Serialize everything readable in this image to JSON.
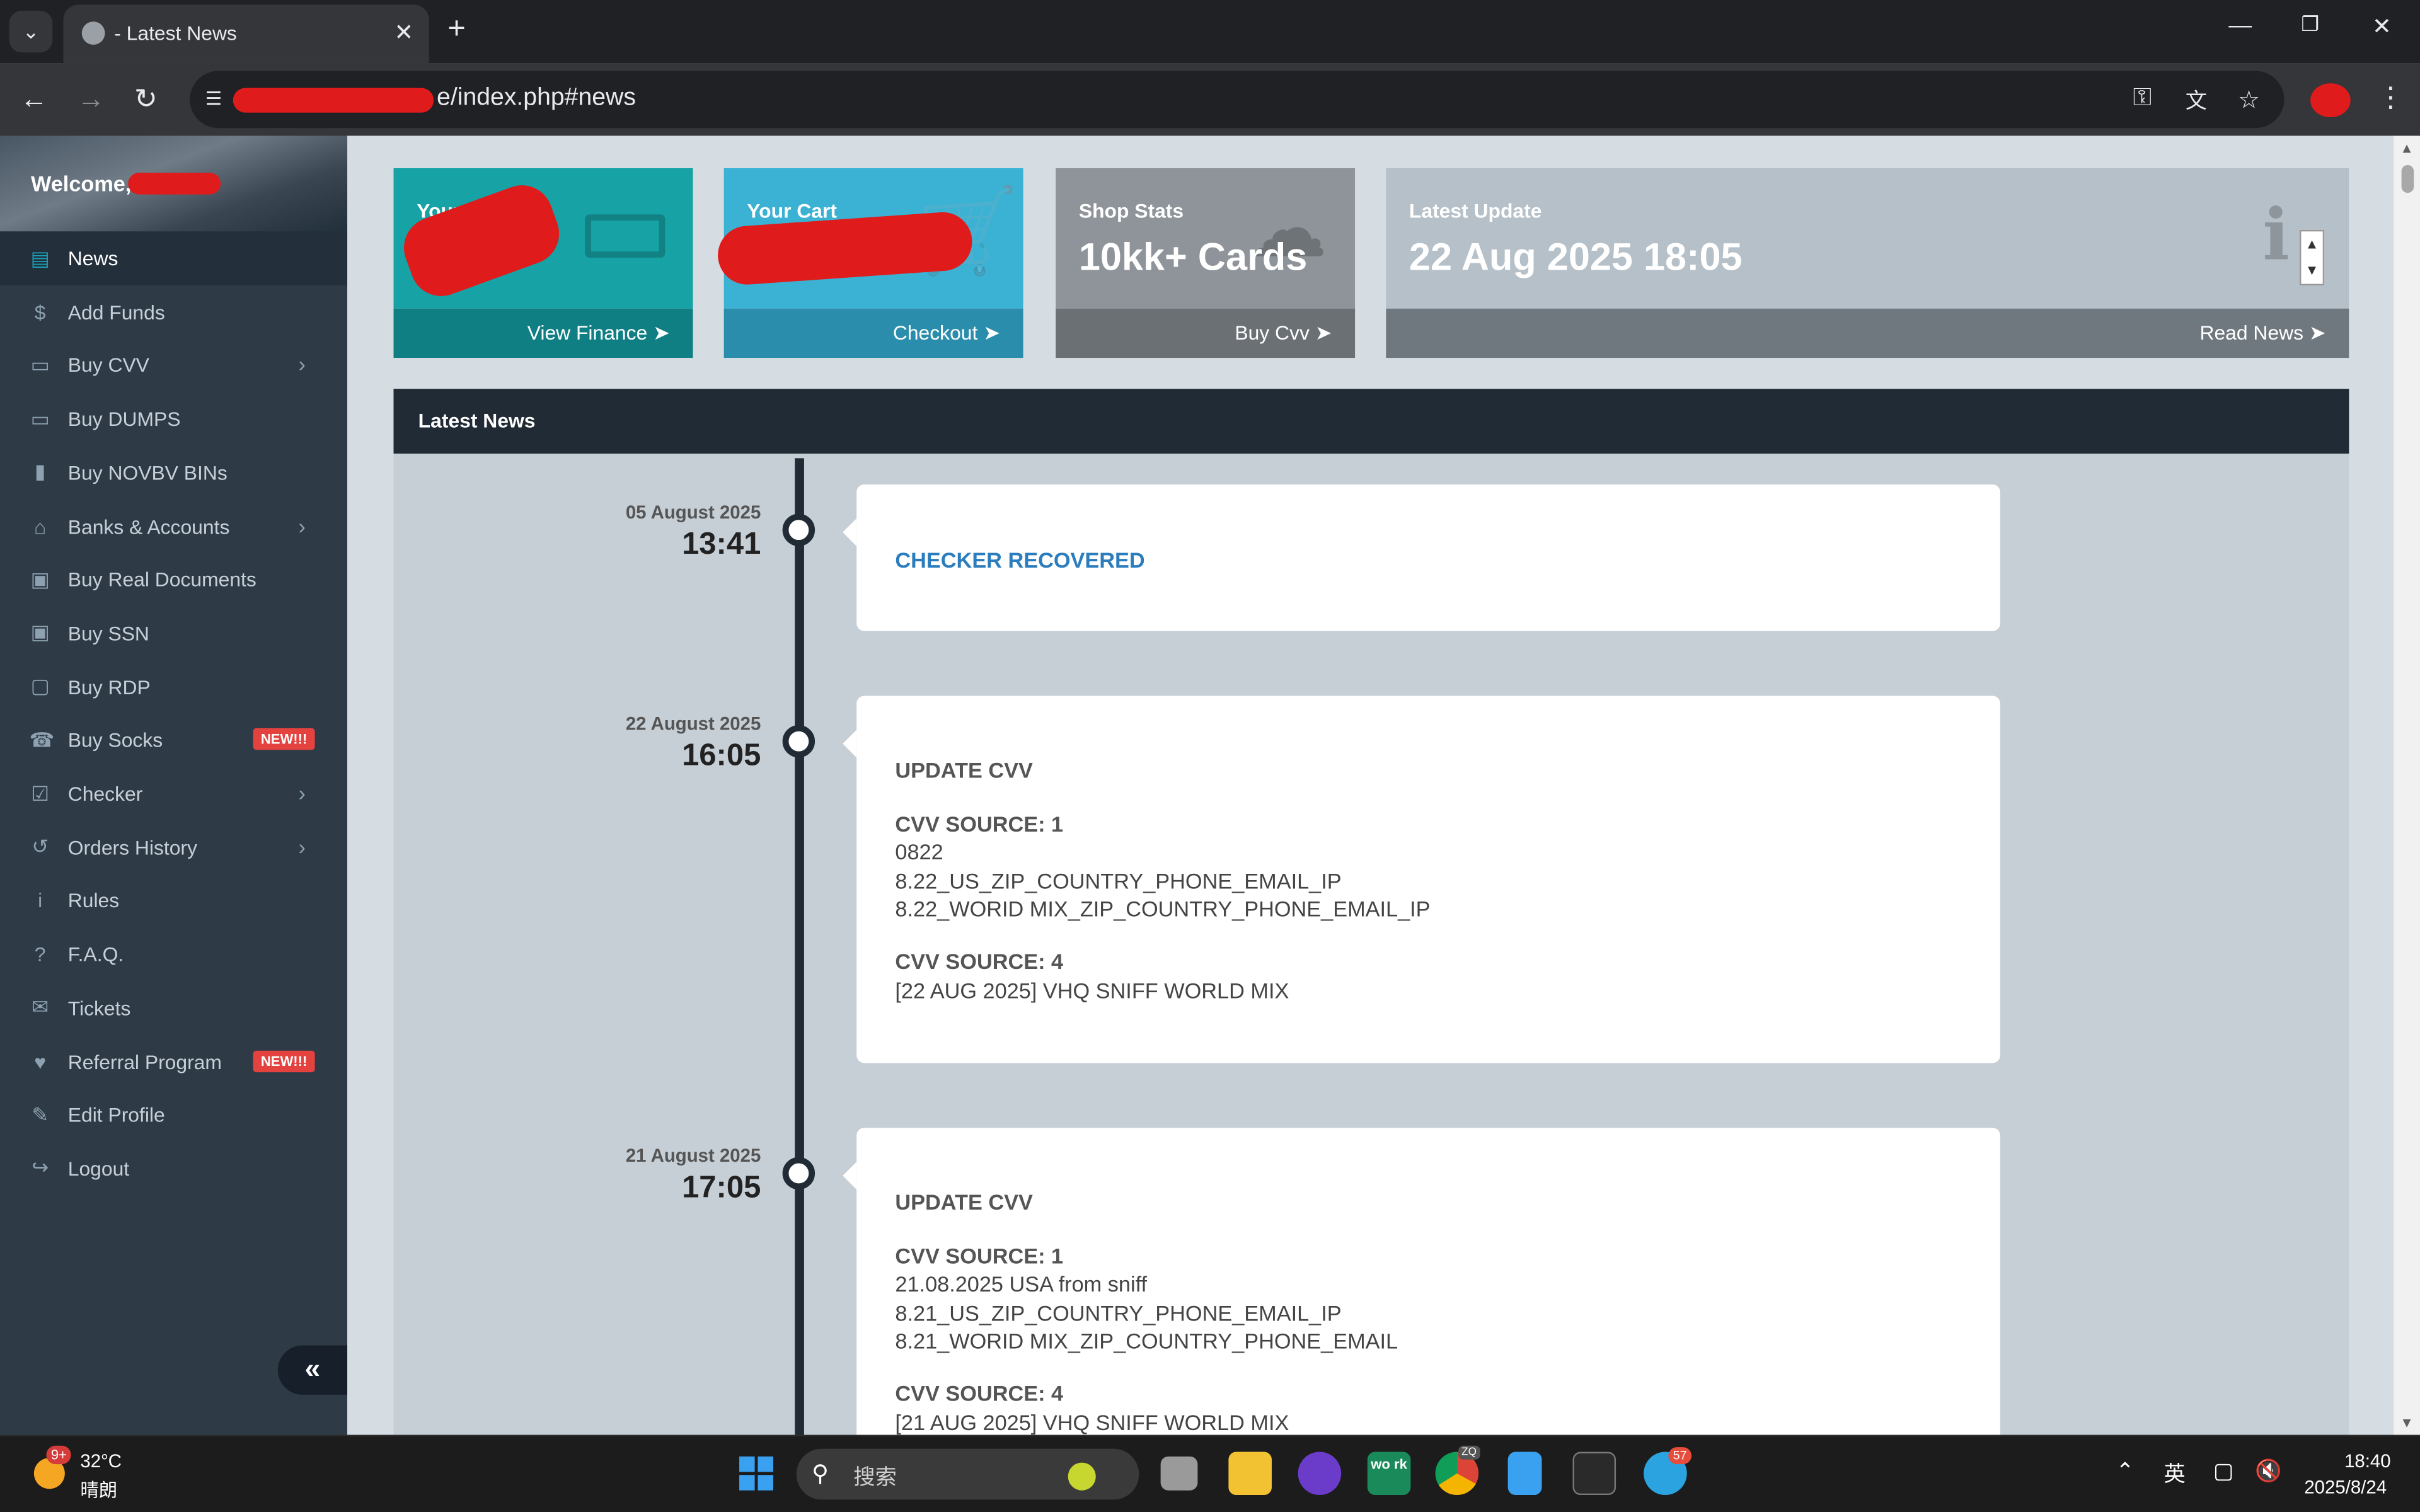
{
  "browser": {
    "tab_title": "- Latest News",
    "url_visible": "e/index.php#news",
    "new_tab": "+",
    "close": "✕"
  },
  "sidebar": {
    "welcome": "Welcome,",
    "items": [
      {
        "label": "News",
        "icon": "news-icon",
        "active": true
      },
      {
        "label": "Add Funds",
        "icon": "dollar-icon"
      },
      {
        "label": "Buy CVV",
        "icon": "credit-card-icon",
        "arrow": true
      },
      {
        "label": "Buy DUMPS",
        "icon": "credit-card-icon"
      },
      {
        "label": "Buy NOVBV BINs",
        "icon": "file-icon"
      },
      {
        "label": "Banks & Accounts",
        "icon": "bank-icon",
        "arrow": true
      },
      {
        "label": "Buy Real Documents",
        "icon": "id-card-icon"
      },
      {
        "label": "Buy SSN",
        "icon": "id-card-icon"
      },
      {
        "label": "Buy RDP",
        "icon": "monitor-icon"
      },
      {
        "label": "Buy Socks",
        "icon": "socks-icon",
        "badge": "NEW!!!"
      },
      {
        "label": "Checker",
        "icon": "checkbox-icon",
        "arrow": true
      },
      {
        "label": "Orders History",
        "icon": "history-icon",
        "arrow": true
      },
      {
        "label": "Rules",
        "icon": "info-icon"
      },
      {
        "label": "F.A.Q.",
        "icon": "question-icon"
      },
      {
        "label": "Tickets",
        "icon": "comments-icon"
      },
      {
        "label": "Referral Program",
        "icon": "handshake-icon",
        "badge": "NEW!!!"
      },
      {
        "label": "Edit Profile",
        "icon": "edit-icon"
      },
      {
        "label": "Logout",
        "icon": "logout-icon"
      }
    ],
    "collapse": "«"
  },
  "stats": [
    {
      "label": "Your Bala",
      "value": "",
      "link": "View Finance",
      "color_top": "#17a2a5",
      "color_bottom": "#0f7f84",
      "icon": "money-icon"
    },
    {
      "label": "Your Cart",
      "value": "",
      "link": "Checkout",
      "color_top": "#3bb1d3",
      "color_bottom": "#2a8dab",
      "icon": "cart-icon"
    },
    {
      "label": "Shop Stats",
      "value": "10kk+ Cards",
      "link": "Buy Cvv",
      "color_top": "#8e9499",
      "color_bottom": "#6b7075",
      "icon": "cloud-icon"
    },
    {
      "label": "Latest Update",
      "value": "22 Aug 2025 18:05",
      "link": "Read News",
      "color_top": "#b6c0c8",
      "color_bottom": "#6f777f",
      "icon": "info-icon"
    }
  ],
  "news": {
    "heading": "Latest News",
    "entries": [
      {
        "date": "05 August 2025",
        "time": "13:41",
        "title": "CHECKER RECOVERED",
        "lines": []
      },
      {
        "date": "22 August 2025",
        "time": "16:05",
        "title": "UPDATE CVV",
        "lines": [
          {
            "text": "CVV SOURCE: 1",
            "bold": true
          },
          {
            "text": "0822"
          },
          {
            "text": "8.22_US_ZIP_COUNTRY_PHONE_EMAIL_IP"
          },
          {
            "text": "8.22_WORID MIX_ZIP_COUNTRY_PHONE_EMAIL_IP"
          },
          {
            "text": "CVV SOURCE: 4",
            "bold": true
          },
          {
            "text": "[22 AUG 2025] VHQ SNIFF WORLD MIX"
          }
        ]
      },
      {
        "date": "21 August 2025",
        "time": "17:05",
        "title": "UPDATE CVV",
        "lines": [
          {
            "text": "CVV SOURCE: 1",
            "bold": true
          },
          {
            "text": "21.08.2025 USA from sniff"
          },
          {
            "text": "8.21_US_ZIP_COUNTRY_PHONE_EMAIL_IP"
          },
          {
            "text": "8.21_WORID MIX_ZIP_COUNTRY_PHONE_EMAIL"
          },
          {
            "text": "CVV SOURCE: 4",
            "bold": true
          },
          {
            "text": "[21 AUG 2025] VHQ SNIFF WORLD MIX"
          }
        ]
      }
    ]
  },
  "taskbar": {
    "weather_badge": "9+",
    "temp": "32°C",
    "condition": "晴朗",
    "search_placeholder": "搜索",
    "telegram_badge": "57",
    "chrome_badge": "ZQ",
    "work_app": "wo rk",
    "ime": "英",
    "time": "18:40",
    "date": "2025/8/24"
  }
}
